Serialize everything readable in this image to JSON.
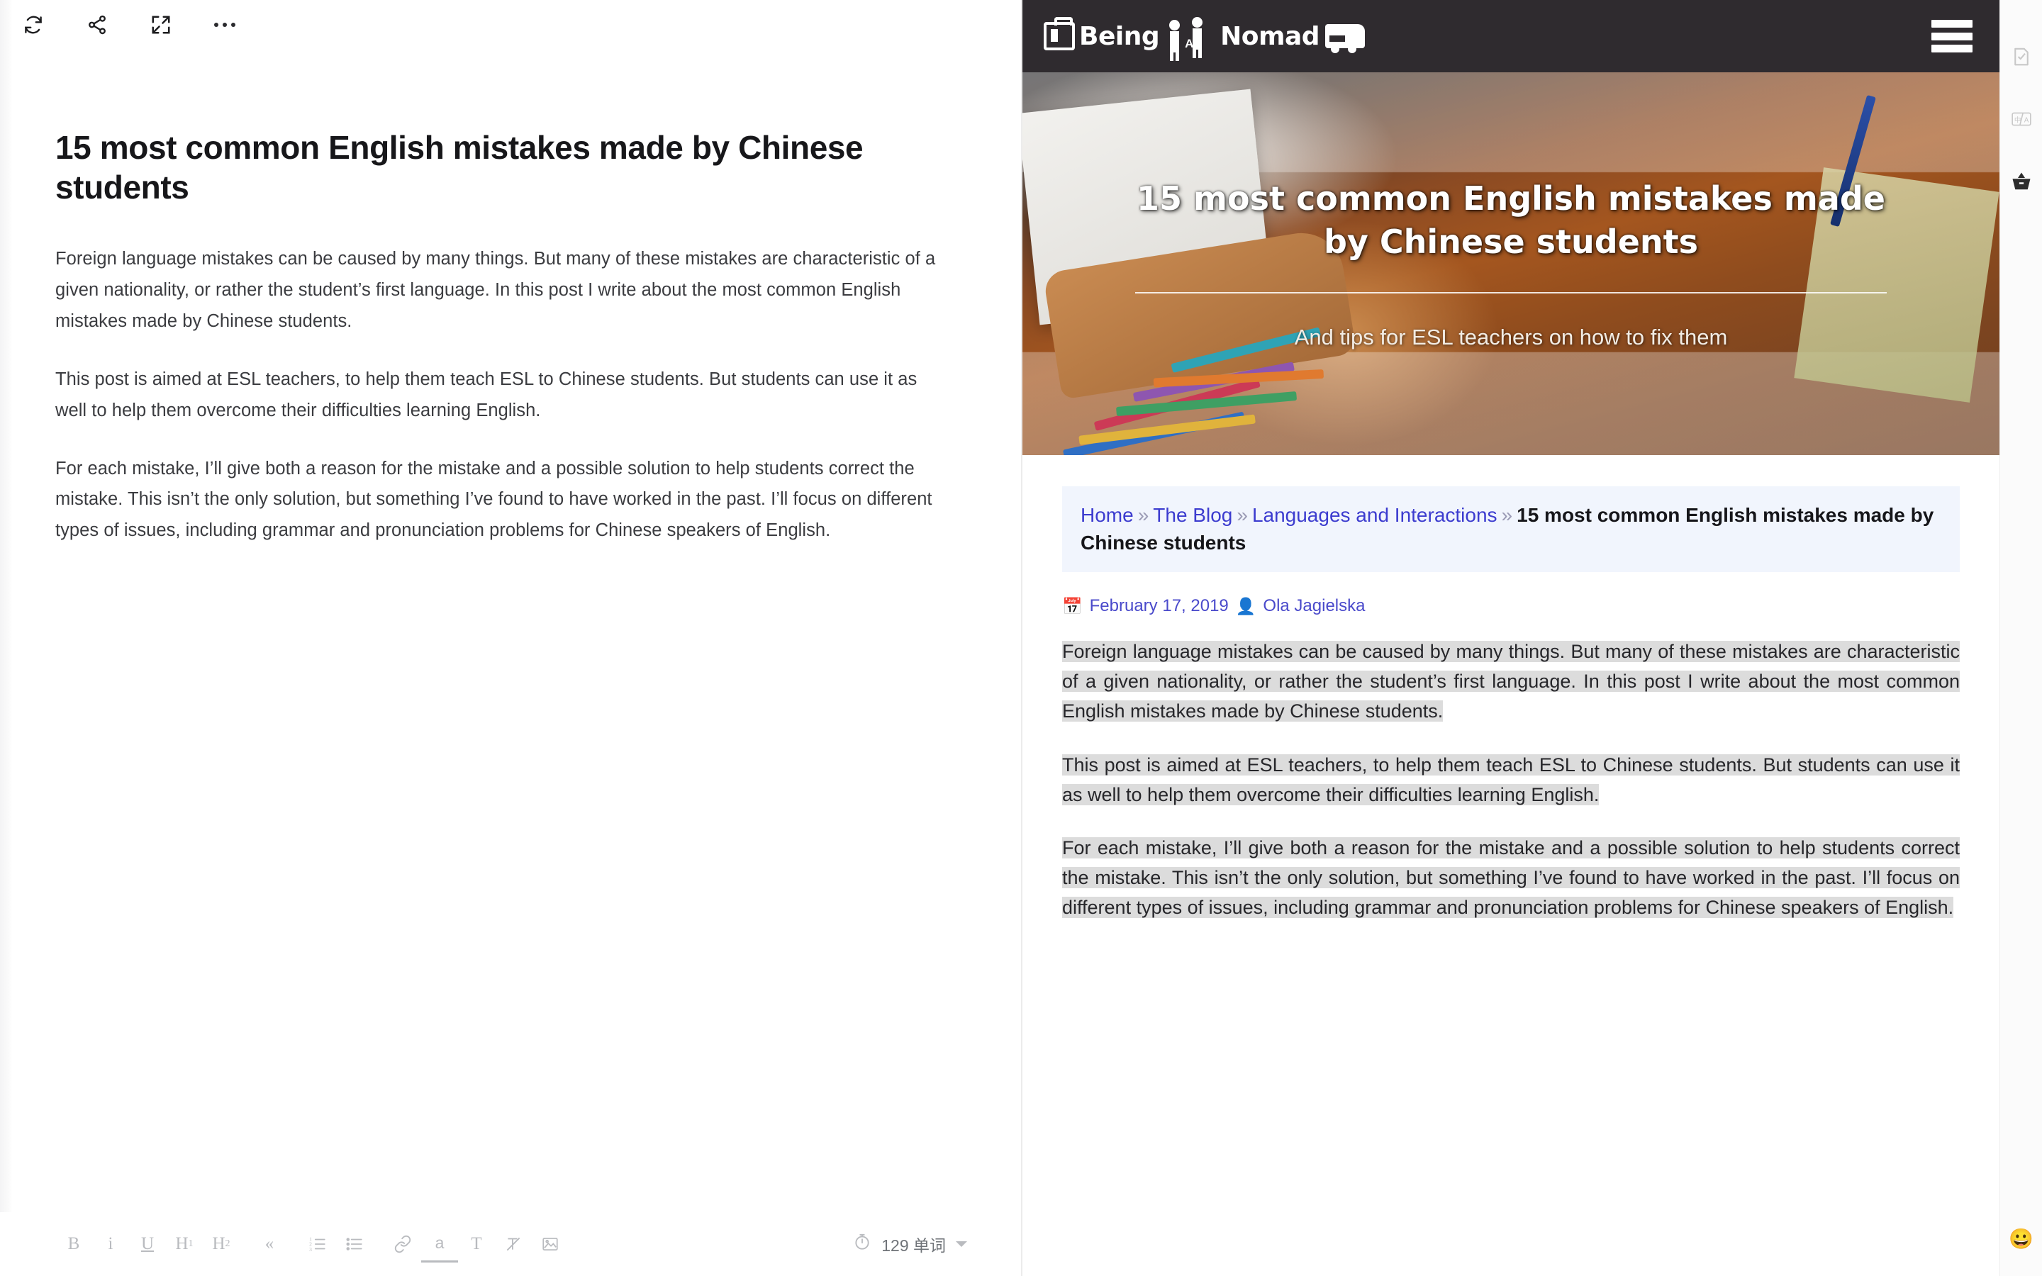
{
  "editor": {
    "toolbar_top": [
      {
        "name": "sync-icon",
        "label": "Sync"
      },
      {
        "name": "share-icon",
        "label": "Share"
      },
      {
        "name": "fullscreen-icon",
        "label": "Fullscreen"
      },
      {
        "name": "more-options-icon",
        "label": "More"
      }
    ],
    "title": "15 most common English mistakes made by Chinese students",
    "paragraphs": [
      "Foreign language mistakes can be caused by many things. But many of these mistakes are characteristic of a given nationality, or rather the student’s first language. In this post I write about the most common English mistakes made by Chinese students.",
      "This post is aimed at ESL teachers, to help them teach ESL to Chinese students. But students can use it as well to help them overcome their difficulties learning English.",
      "For each mistake, I’ll give both a reason for the mistake and a possible solution to help students correct the mistake. This isn’t the only solution, but something I’ve found to have worked in the past. I’ll focus on different types of issues, including grammar and pronunciation problems for Chinese speakers of English."
    ],
    "format_buttons": [
      {
        "name": "bold-button",
        "label": "B"
      },
      {
        "name": "italic-button",
        "label": "i"
      },
      {
        "name": "underline-button",
        "label": "U"
      },
      {
        "name": "heading1-button",
        "label": "H1"
      },
      {
        "name": "heading2-button",
        "label": "H2"
      },
      {
        "name": "blockquote-button",
        "label": "«"
      },
      {
        "name": "ordered-list-button",
        "label": "ol"
      },
      {
        "name": "unordered-list-button",
        "label": "ul"
      },
      {
        "name": "link-button",
        "label": "link"
      },
      {
        "name": "highlight-button",
        "label": "a"
      },
      {
        "name": "text-color-button",
        "label": "T"
      },
      {
        "name": "clear-format-button",
        "label": "Tx"
      },
      {
        "name": "insert-image-button",
        "label": "img"
      }
    ],
    "word_count": "129 单词",
    "timer_icon": "timer-icon"
  },
  "site": {
    "logo_text_1": "Being",
    "logo_letter": "A",
    "logo_text_2": "Nomad",
    "menu_icon": "hamburger-menu-icon",
    "hero": {
      "title": "15 most common English mistakes made by Chinese students",
      "subtitle": "And tips for ESL teachers on how to fix them"
    },
    "breadcrumb": {
      "items": [
        {
          "label": "Home",
          "link": true
        },
        {
          "label": "The Blog",
          "link": true
        },
        {
          "label": "Languages and Interactions",
          "link": true
        },
        {
          "label": "15 most common English mistakes made by Chinese students",
          "link": false
        }
      ],
      "separator": "»"
    },
    "meta": {
      "date": "February 17, 2019",
      "author": "Ola Jagielska",
      "date_icon": "calendar-icon",
      "author_icon": "user-icon"
    },
    "paragraphs": [
      "Foreign language mistakes can be caused by many things. But many of these mistakes are characteristic of a given nationality, or rather the student’s first language. In this post I write about the most common English mistakes made by Chinese students.",
      "This post is aimed at ESL teachers, to help them teach ESL to Chinese students. But students can use it as well to help them overcome their difficulties learning English.",
      "For each mistake, I’ll give both a reason for the mistake and a possible solution to help students correct the mistake. This isn’t the only solution, but something I’ve found to have worked in the past. I’ll focus on different types of issues, including grammar and pronunciation problems for Chinese speakers of English."
    ]
  },
  "rail": {
    "items": [
      {
        "name": "document-check-icon",
        "label": "Proofread"
      },
      {
        "name": "translate-icon",
        "label": "Translate"
      },
      {
        "name": "toolbox-icon",
        "label": "Toolbox"
      }
    ],
    "emoji": "😀"
  },
  "colors": {
    "header_bg": "#2f2b2f",
    "breadcrumb_bg": "#f1f5fd",
    "link": "#3c3ccf",
    "selection": "#dcdcdc"
  }
}
